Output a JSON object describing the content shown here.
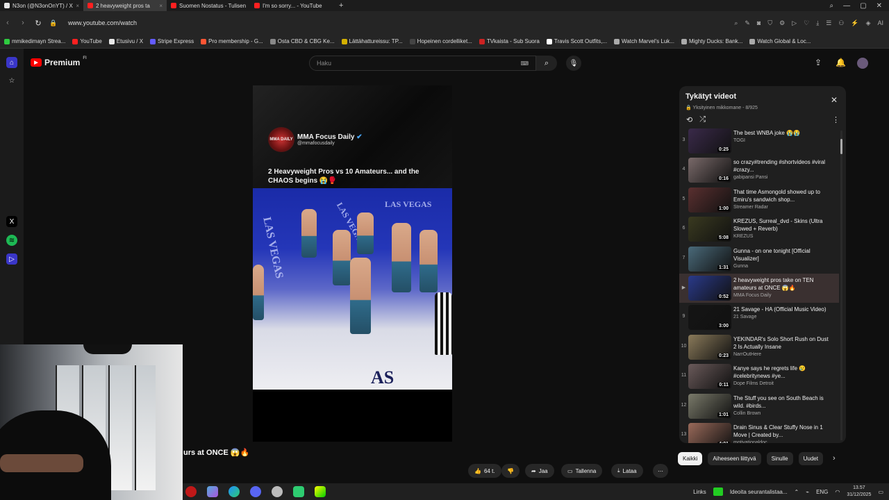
{
  "browser": {
    "tabs": [
      {
        "title": "N3on (@N3onOnYT) / X",
        "icon_color": "#e8e8e8"
      },
      {
        "title": "2 heavyweight pros ta",
        "icon_color": "#ff2020"
      },
      {
        "title": "Suomen Nostatus - Tulisen",
        "icon_color": "#ff2020"
      },
      {
        "title": "I'm so sorry... - YouTube",
        "icon_color": "#ff2020"
      }
    ],
    "add_tab": "+",
    "url": "www.youtube.com/watch",
    "bookmarks": [
      {
        "label": "mmikedimayn Strea...",
        "color": "#2ecc40"
      },
      {
        "label": "YouTube",
        "color": "#ff2020"
      },
      {
        "label": "Etusivu / X",
        "color": "#e8e8e8"
      },
      {
        "label": "Stripe Express",
        "color": "#635bff"
      },
      {
        "label": "Pro membership - G...",
        "color": "#ff5533"
      },
      {
        "label": "Osta CBD & CBG Ke...",
        "color": "#888888"
      },
      {
        "label": "Lättähattureissu: TP...",
        "color": "#d4b000"
      },
      {
        "label": "Hopeinen cordelliket...",
        "color": "#444444"
      },
      {
        "label": "TVkaista - Sub Suora",
        "color": "#cc2222"
      },
      {
        "label": "Travis Scott Outfits,...",
        "color": "#ffffff"
      },
      {
        "label": "Watch Marvel's Luk...",
        "color": "#aaaaaa"
      },
      {
        "label": "Mighty Ducks: Bank...",
        "color": "#aaaaaa"
      },
      {
        "label": "Watch Global & Loc...",
        "color": "#aaaaaa"
      }
    ]
  },
  "youtube": {
    "logo_text": "Premium",
    "logo_sup": "FI",
    "search_placeholder": "Haku",
    "keyboard_icon": "⌨"
  },
  "video": {
    "channel_name": "MMA Focus Daily",
    "channel_handle": "@mmafocusdaily",
    "logo_text": "MMA DAILY",
    "overlay_caption": "2 Heavyweight Pros vs 10 Amateurs... and the CHAOS begins 😭🥊",
    "bottom_caption": "urs at ONCE 😱🔥",
    "arena_text": "LAS VEGAS",
    "floor_logo": "AS"
  },
  "actions": {
    "like_count": "64 t.",
    "share": "Jaa",
    "save": "Tallenna",
    "download": "Lataa"
  },
  "playlist": {
    "title": "Tykätyt videot",
    "subtitle": "Yksityinen mikkomane - 8/925",
    "items": [
      {
        "index": "3",
        "title": "The best WNBA joke 😭😭",
        "channel": "TOGI",
        "duration": "0:25",
        "thumb": "#3a2a4a"
      },
      {
        "index": "4",
        "title": "so crazy#trending #shortvideos #viral #crazy...",
        "channel": "gabipansi Pansi",
        "duration": "0:16",
        "thumb": "#7a6a6a"
      },
      {
        "index": "5",
        "title": "That time Asmongold showed up to Emiru's sandwich shop...",
        "channel": "Streamer Radar",
        "duration": "1:00",
        "thumb": "#5a3030"
      },
      {
        "index": "6",
        "title": "KREZUS, Surreal_dvd - Skins (Ultra Slowed + Reverb)",
        "channel": "KREZUS",
        "duration": "5:08",
        "thumb": "#3a3a20"
      },
      {
        "index": "7",
        "title": "Gunna - on one tonight [Official Visualizer]",
        "channel": "Gunna",
        "duration": "1:31",
        "thumb": "#4a6a7a"
      },
      {
        "index": "▶",
        "title": "2 heavyweight pros take on TEN amateurs at ONCE 😱🔥",
        "channel": "MMA Focus Daily",
        "duration": "0:52",
        "thumb": "#2a3a8a",
        "active": true
      },
      {
        "index": "9",
        "title": "21 Savage - HA (Official Music Video)",
        "channel": "21 Savage",
        "duration": "3:00",
        "thumb": "#151515"
      },
      {
        "index": "10",
        "title": "YEKINDAR's Solo Short Rush on Dust 2 Is Actually Insane",
        "channel": "NarrOutHere",
        "duration": "0:23",
        "thumb": "#8a7a5a"
      },
      {
        "index": "11",
        "title": "Kanye says he regrets life 😢 #celebritynews #ye...",
        "channel": "Dope Films Detroit",
        "duration": "0:11",
        "thumb": "#6a5a5a"
      },
      {
        "index": "12",
        "title": "The Stuff you see on South Beach is wild. #birds...",
        "channel": "Collin Brown",
        "duration": "1:01",
        "thumb": "#7a7a6a"
      },
      {
        "index": "13",
        "title": "Drain Sinus & Clear Stuffy Nose in 1 Move | Created by...",
        "channel": "motivationaldoc",
        "duration": "4:01",
        "thumb": "#9a6a5a"
      }
    ]
  },
  "chips": [
    "Kaikki",
    "Aiheeseen liittyvä",
    "Sinulle",
    "Uudet"
  ],
  "taskbar": {
    "links_label": "Links",
    "notification_text": "Ideoita seurantalistaa...",
    "language": "ENG",
    "time": "13.57",
    "date": "31/12/2025"
  }
}
